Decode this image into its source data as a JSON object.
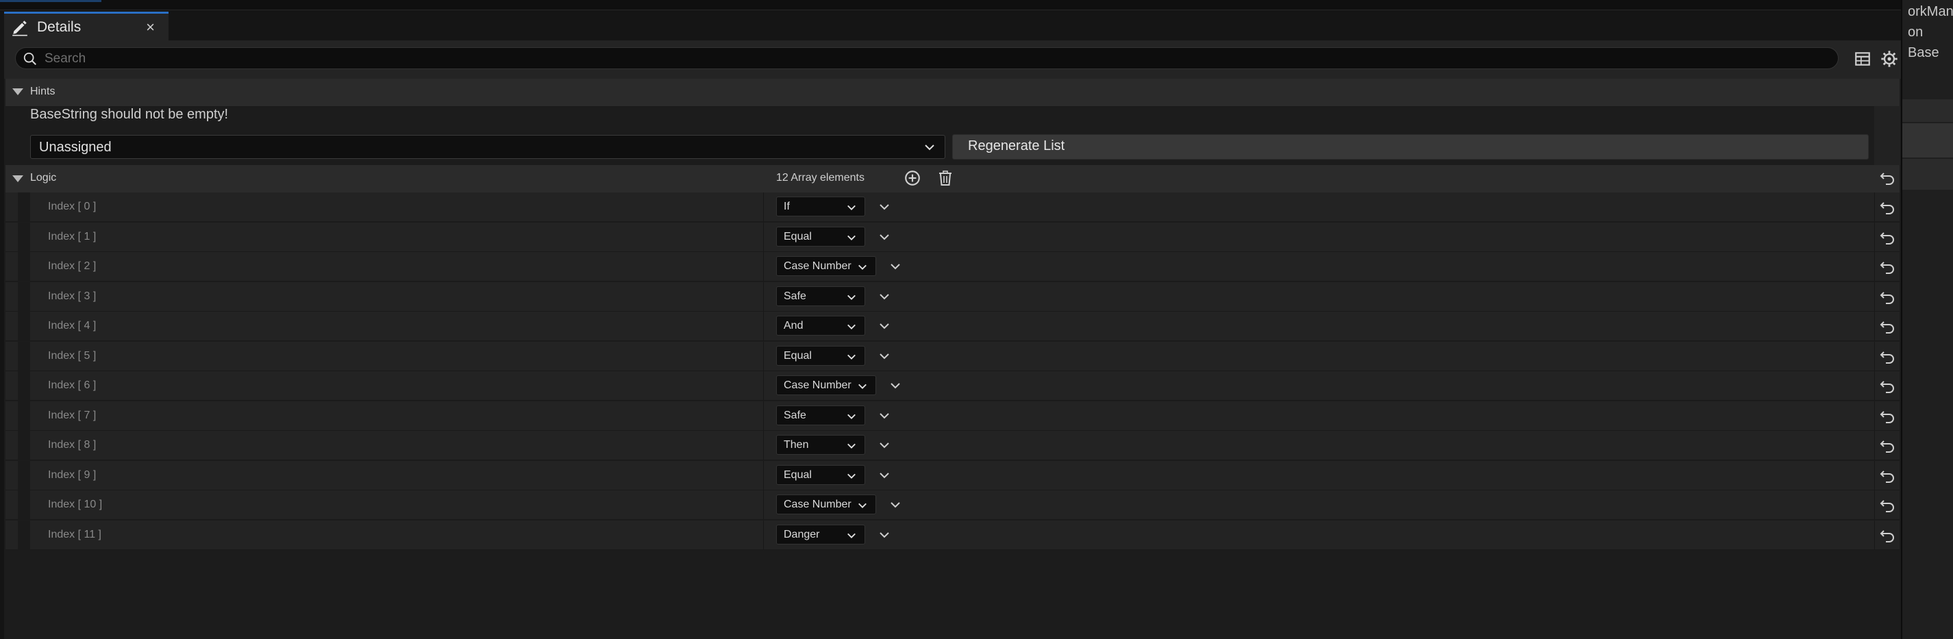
{
  "tab": {
    "title": "Details",
    "close": "×",
    "icon": "pencil-icon"
  },
  "search": {
    "placeholder": "Search"
  },
  "categories": {
    "hints": "Hints",
    "logic": "Logic"
  },
  "hints": {
    "message": "BaseString should not be empty!",
    "dropdown_value": "Unassigned",
    "regenerate_label": "Regenerate List"
  },
  "logic": {
    "count_label": "12 Array elements",
    "items": [
      {
        "label": "Index [ 0 ]",
        "value": "If"
      },
      {
        "label": "Index [ 1 ]",
        "value": "Equal"
      },
      {
        "label": "Index [ 2 ]",
        "value": "Case Number"
      },
      {
        "label": "Index [ 3 ]",
        "value": "Safe"
      },
      {
        "label": "Index [ 4 ]",
        "value": "And"
      },
      {
        "label": "Index [ 5 ]",
        "value": "Equal"
      },
      {
        "label": "Index [ 6 ]",
        "value": "Case Number"
      },
      {
        "label": "Index [ 7 ]",
        "value": "Safe"
      },
      {
        "label": "Index [ 8 ]",
        "value": "Then"
      },
      {
        "label": "Index [ 9 ]",
        "value": "Equal"
      },
      {
        "label": "Index [ 10 ]",
        "value": "Case Number"
      },
      {
        "label": "Index [ 11 ]",
        "value": "Danger"
      }
    ]
  },
  "right_panel": {
    "lines": [
      "orkMana",
      "on",
      "Base"
    ]
  },
  "colors": {
    "accent": "#2a6fc4",
    "panel": "#1c1c1c",
    "row": "#232323"
  }
}
